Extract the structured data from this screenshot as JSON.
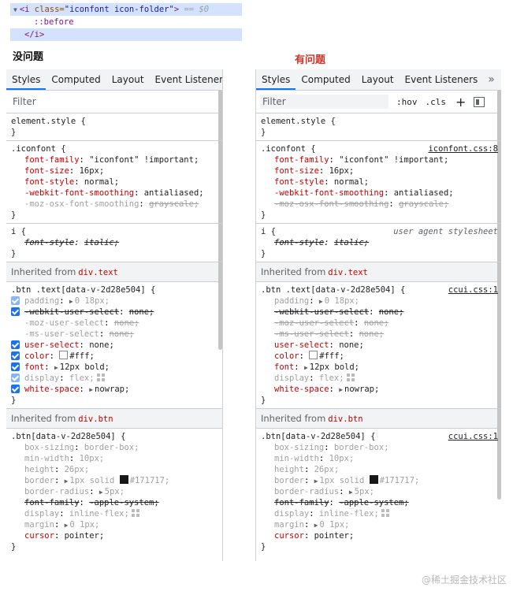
{
  "dom": {
    "line1_tag_open": "<i",
    "line1_attr": " class=",
    "line1_value": "\"iconfont icon-folder\"",
    "line1_close": ">",
    "line1_eq": "== $0",
    "line2": "::before",
    "line3": "</i>"
  },
  "headers": {
    "left": "没问题",
    "right": "有问题"
  },
  "tabs": {
    "styles": "Styles",
    "computed": "Computed",
    "layout": "Layout",
    "events": "Event Listeners",
    "more": "»"
  },
  "filter": {
    "placeholder": "Filter",
    "hov": ":hov",
    "cls": ".cls",
    "plus": "+"
  },
  "rules": {
    "element_style": "element.style {",
    "close": "}",
    "iconfont_sel": ".iconfont {",
    "iconfont_src": "iconfont.css:8",
    "i_sel": "i {",
    "ua_src": "user agent stylesheet",
    "btn_text_sel": ".btn .text[data-v-2d28e504] {",
    "btn_sel": ".btn[data-v-2d28e504] {",
    "ccui_src": "ccui.css:1"
  },
  "decls": {
    "font_family_p": "font-family",
    "font_family_v": "\"iconfont\" !important;",
    "font_size_p": "font-size",
    "font_size_v": "16px;",
    "font_style_p": "font-style",
    "font_style_v": "normal;",
    "webkit_smooth_p": "-webkit-font-smoothing",
    "webkit_smooth_v": "antialiased;",
    "moz_smooth_p": "-moz-osx-font-smoothing",
    "moz_smooth_v": "grayscale;",
    "i_font_style_p": "font-style",
    "i_font_style_v": "italic;",
    "padding_p": "padding",
    "padding_v": "0 18px;",
    "webkit_us_p": "-webkit-user-select",
    "none_v": "none;",
    "moz_us_p": "-moz-user-select",
    "ms_us_p": "-ms-user-select",
    "us_p": "user-select",
    "color_p": "color",
    "color_v": "#fff;",
    "font_p": "font",
    "font_v": "12px bold;",
    "display_p": "display",
    "display_v": "flex;",
    "ws_p": "white-space",
    "ws_v": "nowrap;",
    "box_sizing_p": "box-sizing",
    "box_sizing_v": "border-box;",
    "min_width_p": "min-width",
    "min_width_v": "10px;",
    "height_p": "height",
    "height_v": "26px;",
    "border_p": "border",
    "border_v1": "1px solid",
    "border_v2": "#171717;",
    "border_radius_p": "border-radius",
    "border_radius_v": "5px;",
    "btn_ff_p": "font-family",
    "btn_ff_v": "-apple-system;",
    "display2_v": "inline-flex;",
    "margin_p": "margin",
    "margin_v": "0 1px;",
    "cursor_p": "cursor",
    "cursor_v": "pointer;"
  },
  "inherited": {
    "label": "Inherited from",
    "text_from": "div.text",
    "btn_from": "div.btn"
  },
  "watermark": "@稀土掘金技术社区",
  "colors": {
    "accent": "#1a73e8",
    "property": "#c80000",
    "alert": "#d93025"
  }
}
